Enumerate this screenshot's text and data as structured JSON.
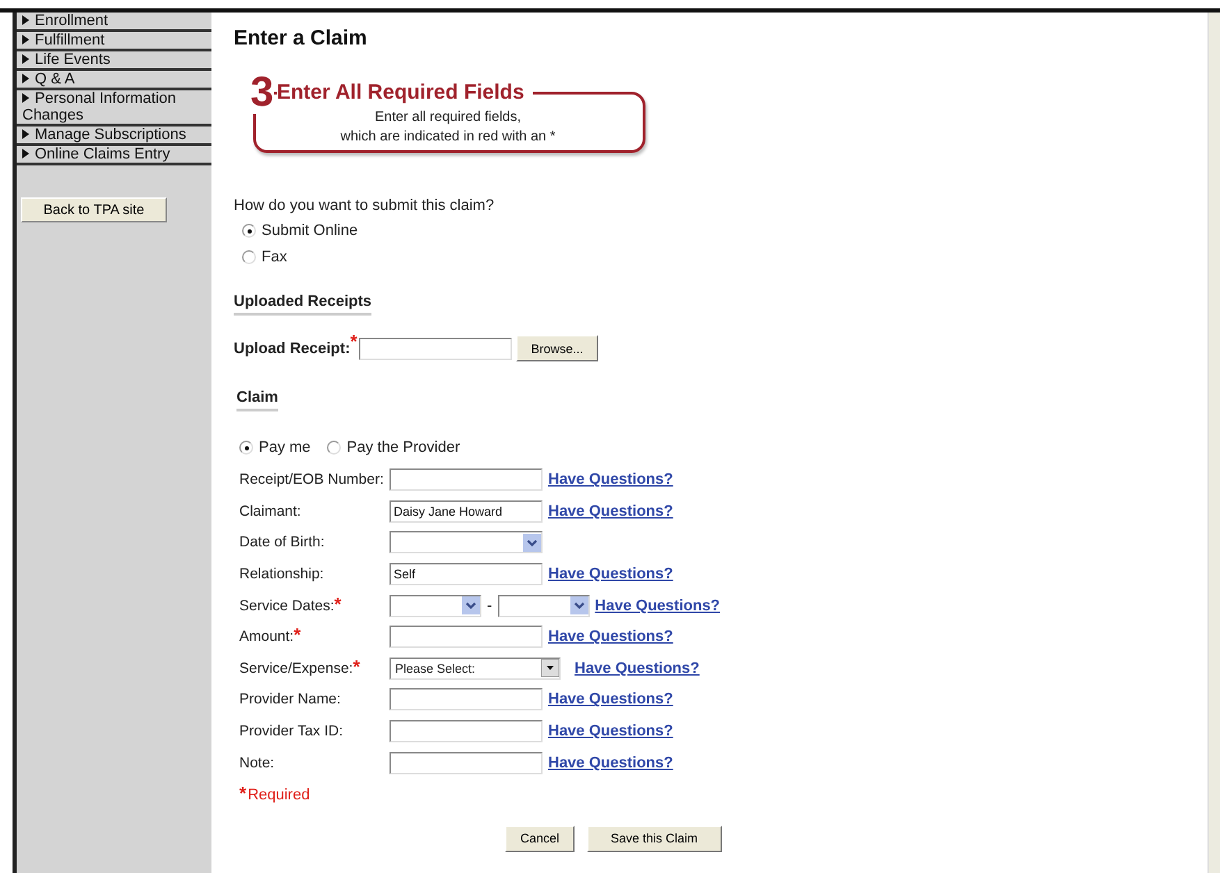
{
  "sidebar": {
    "items": [
      {
        "label": "Enrollment"
      },
      {
        "label": "Fulfillment"
      },
      {
        "label": "Life Events"
      },
      {
        "label": "Q & A"
      },
      {
        "label": "Personal Information Changes"
      },
      {
        "label": "Manage Subscriptions"
      },
      {
        "label": "Online Claims Entry"
      }
    ],
    "back_button": "Back to TPA site"
  },
  "page_title": "Enter a Claim",
  "step": {
    "number": "3",
    "title": "Enter All Required Fields",
    "text_lines": [
      "Enter all required fields,",
      "which are indicated in red with an *"
    ]
  },
  "submit_question": "How do you want to submit this claim?",
  "submit_options": [
    {
      "label": "Submit Online",
      "selected": true
    },
    {
      "label": "Fax",
      "selected": false
    }
  ],
  "uploaded_receipts": {
    "heading": "Uploaded Receipts",
    "label": "Upload Receipt:",
    "required": true,
    "browse_button": "Browse..."
  },
  "claim": {
    "heading": "Claim",
    "payee_options": [
      {
        "label": "Pay me",
        "selected": true
      },
      {
        "label": "Pay the Provider",
        "selected": false
      }
    ],
    "fields": [
      {
        "label": "Receipt/EOB Number:",
        "kind": "text",
        "required": false,
        "link": "Have Questions?"
      },
      {
        "label": "Claimant:",
        "kind": "text",
        "required": false,
        "value": "Daisy Jane Howard",
        "link": "Have Questions?"
      },
      {
        "label": "Date of Birth:",
        "kind": "select",
        "required": false
      },
      {
        "label": "Relationship:",
        "kind": "text",
        "required": false,
        "value": "Self",
        "link": "Have Questions?"
      },
      {
        "label": "Service Dates:",
        "kind": "date_range",
        "required": true,
        "separator": "-",
        "link": "Have Questions?"
      },
      {
        "label": "Amount:",
        "kind": "text",
        "required": true,
        "link": "Have Questions?"
      },
      {
        "label": "Service/Expense:",
        "kind": "dropdown",
        "required": true,
        "value": "Please Select:",
        "link": "Have Questions?"
      },
      {
        "label": "Provider Name:",
        "kind": "text",
        "required": false,
        "link": "Have Questions?"
      },
      {
        "label": "Provider Tax ID:",
        "kind": "text",
        "required": false,
        "link": "Have Questions?"
      },
      {
        "label": "Note:",
        "kind": "text",
        "required": false,
        "link": "Have Questions?"
      }
    ],
    "required_note": {
      "mark": "*",
      "text": "Required"
    }
  },
  "buttons": [
    {
      "label": "Cancel",
      "kind": "cancel"
    },
    {
      "label": "Save this Claim",
      "kind": "save"
    }
  ]
}
